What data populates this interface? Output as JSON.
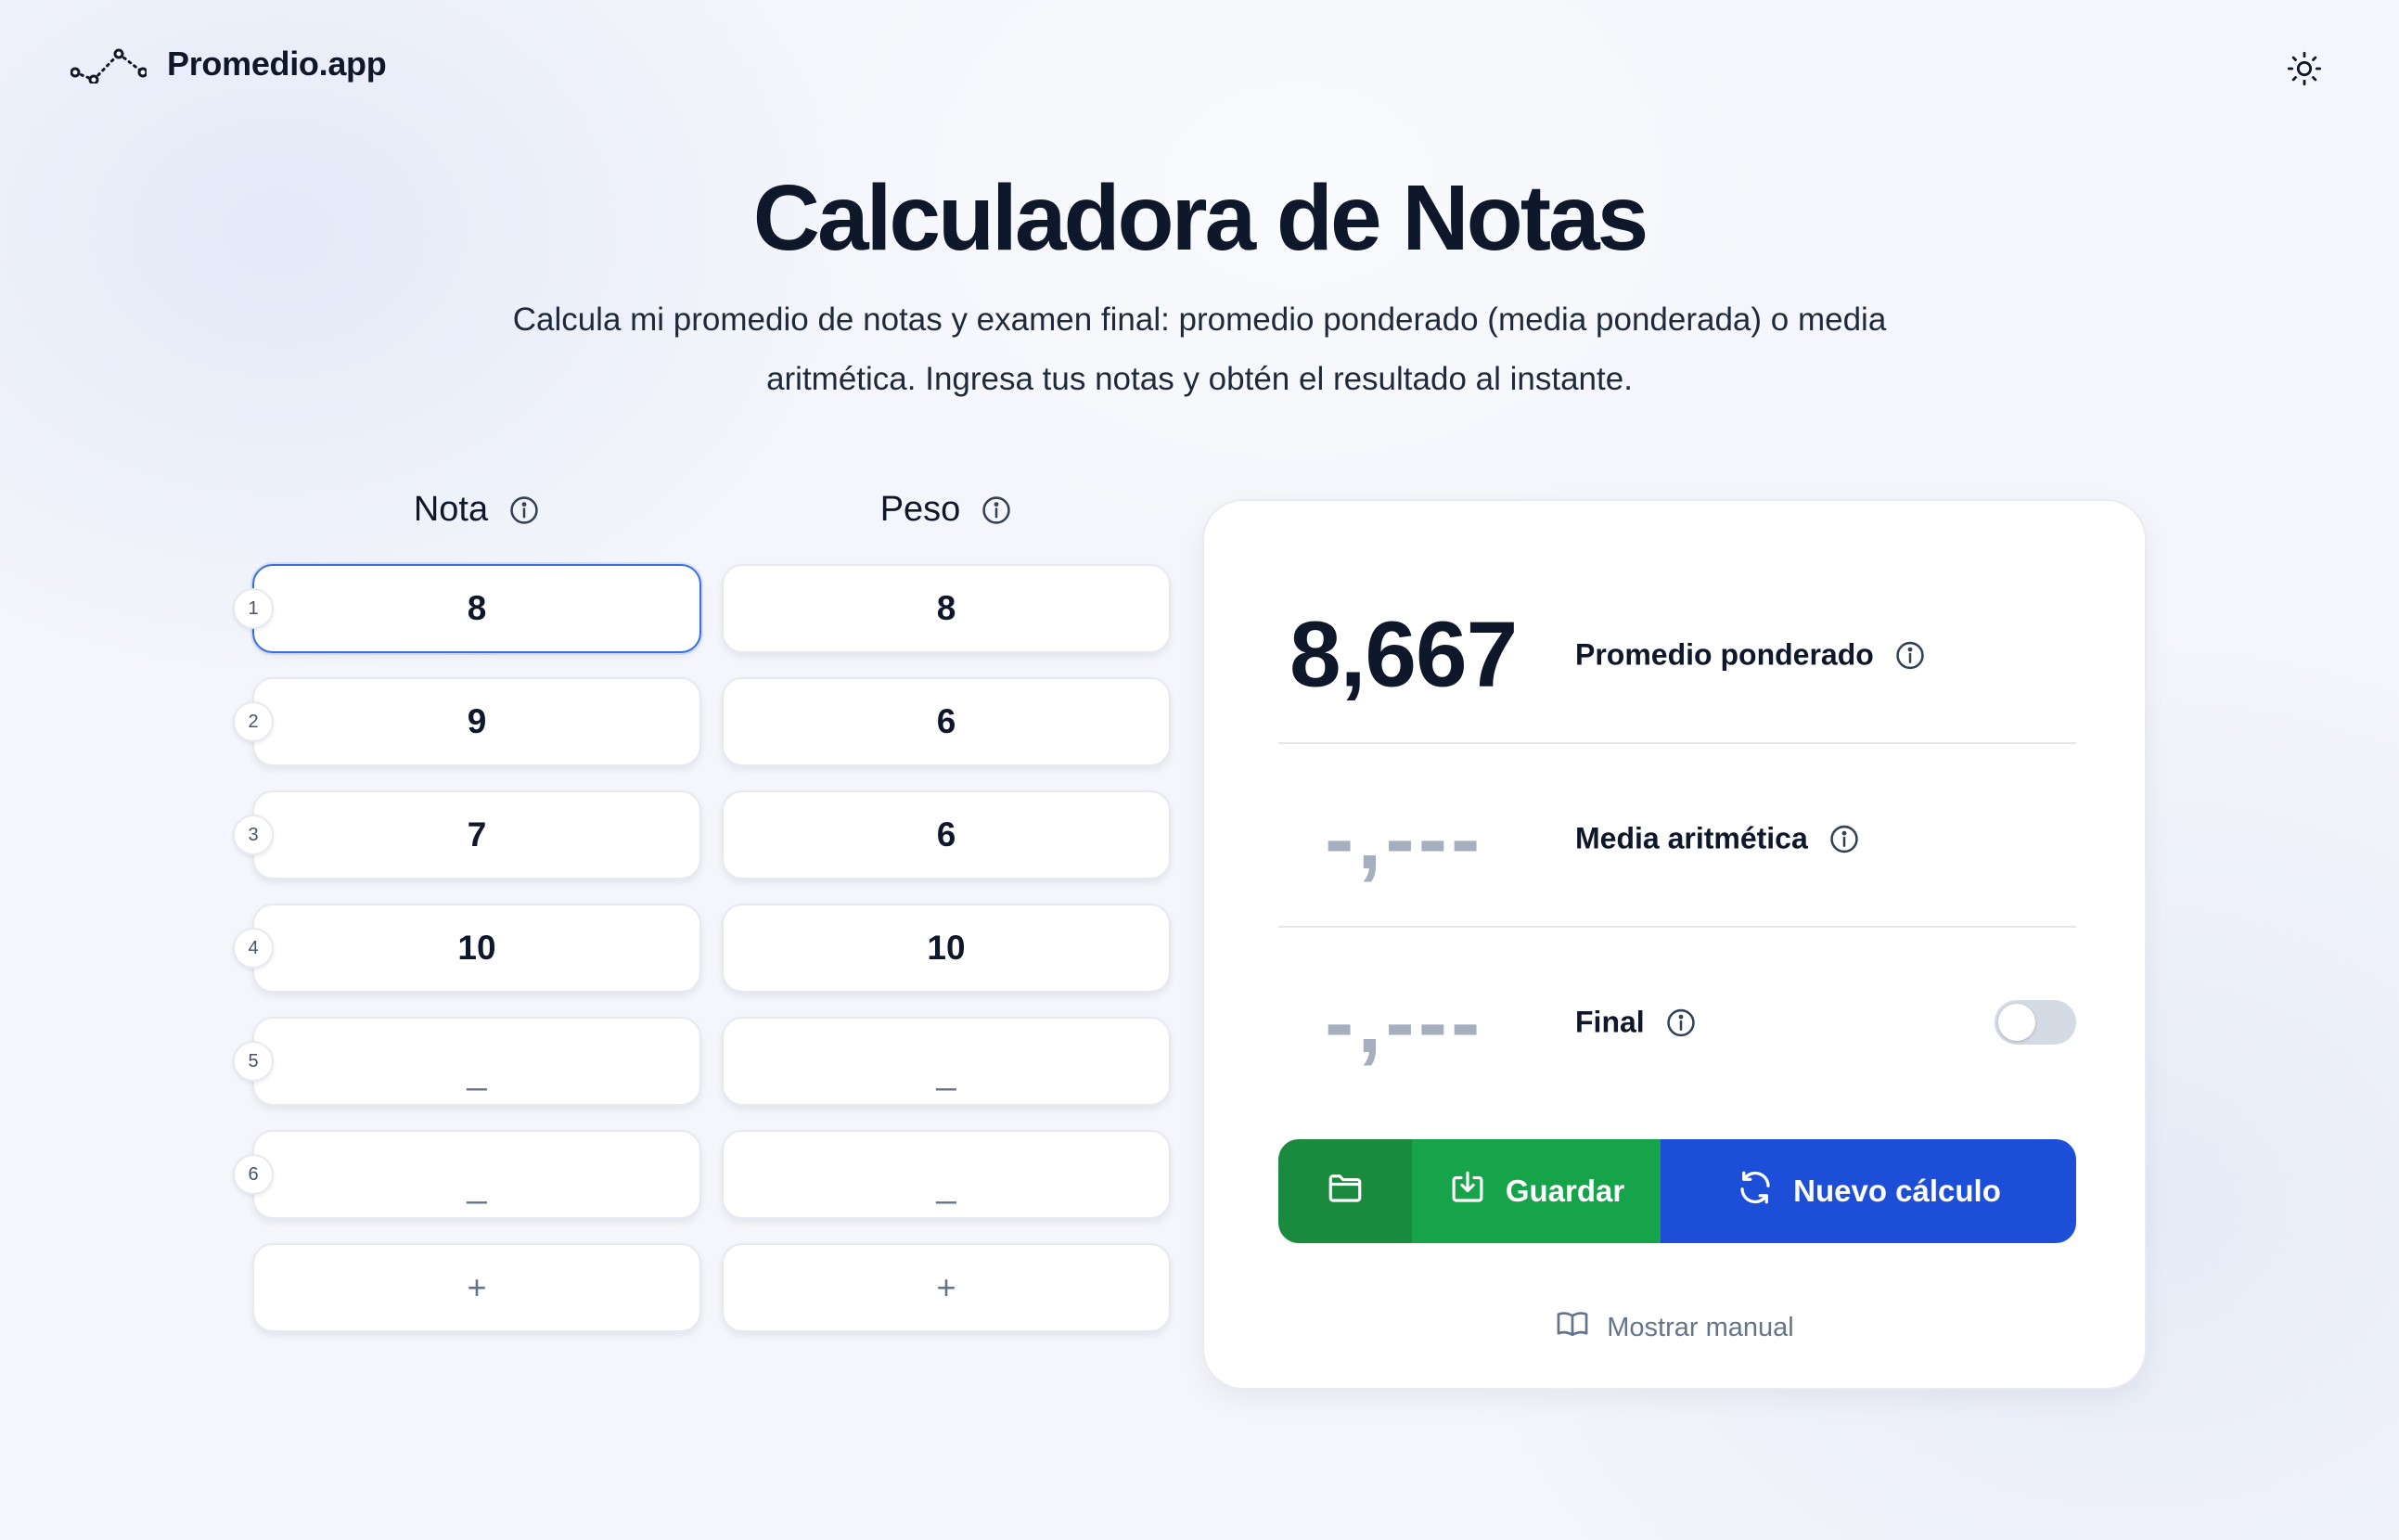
{
  "header": {
    "logo_text": "Promedio.app",
    "logo_icon": "chart-line-icon",
    "theme_icon": "sun-icon"
  },
  "hero": {
    "title": "Calculadora de Notas",
    "subtitle": "Calcula mi promedio de notas y examen final: promedio ponderado (media ponderada) o media aritmética. Ingresa tus notas y obtén el resultado al instante."
  },
  "columns": {
    "nota_label": "Nota",
    "peso_label": "Peso",
    "info_icon": "info-icon"
  },
  "rows": [
    {
      "index": "1",
      "nota": "8",
      "peso": "8"
    },
    {
      "index": "2",
      "nota": "9",
      "peso": "6"
    },
    {
      "index": "3",
      "nota": "7",
      "peso": "6"
    },
    {
      "index": "4",
      "nota": "10",
      "peso": "10"
    },
    {
      "index": "5",
      "nota": "_",
      "peso": "_"
    },
    {
      "index": "6",
      "nota": "_",
      "peso": "_"
    }
  ],
  "add_label": "+",
  "results": {
    "weighted": {
      "value": "8,667",
      "label": "Promedio ponderado"
    },
    "arithmetic": {
      "value": "-,---",
      "label": "Media aritmética"
    },
    "final": {
      "value": "-,---",
      "label": "Final",
      "toggle_on": false
    }
  },
  "actions": {
    "open_icon": "folder-icon",
    "save_label": "Guardar",
    "save_icon": "download-icon",
    "new_label": "Nuevo cálculo",
    "new_icon": "refresh-icon"
  },
  "manual": {
    "label": "Mostrar manual",
    "icon": "book-icon"
  },
  "colors": {
    "accent_blue": "#1d4ed8",
    "save_green": "#16a34a",
    "folder_green": "#1a8a3e",
    "focus_border": "#3b6fe0",
    "text_dark": "#0f172a",
    "muted": "#64748b"
  }
}
